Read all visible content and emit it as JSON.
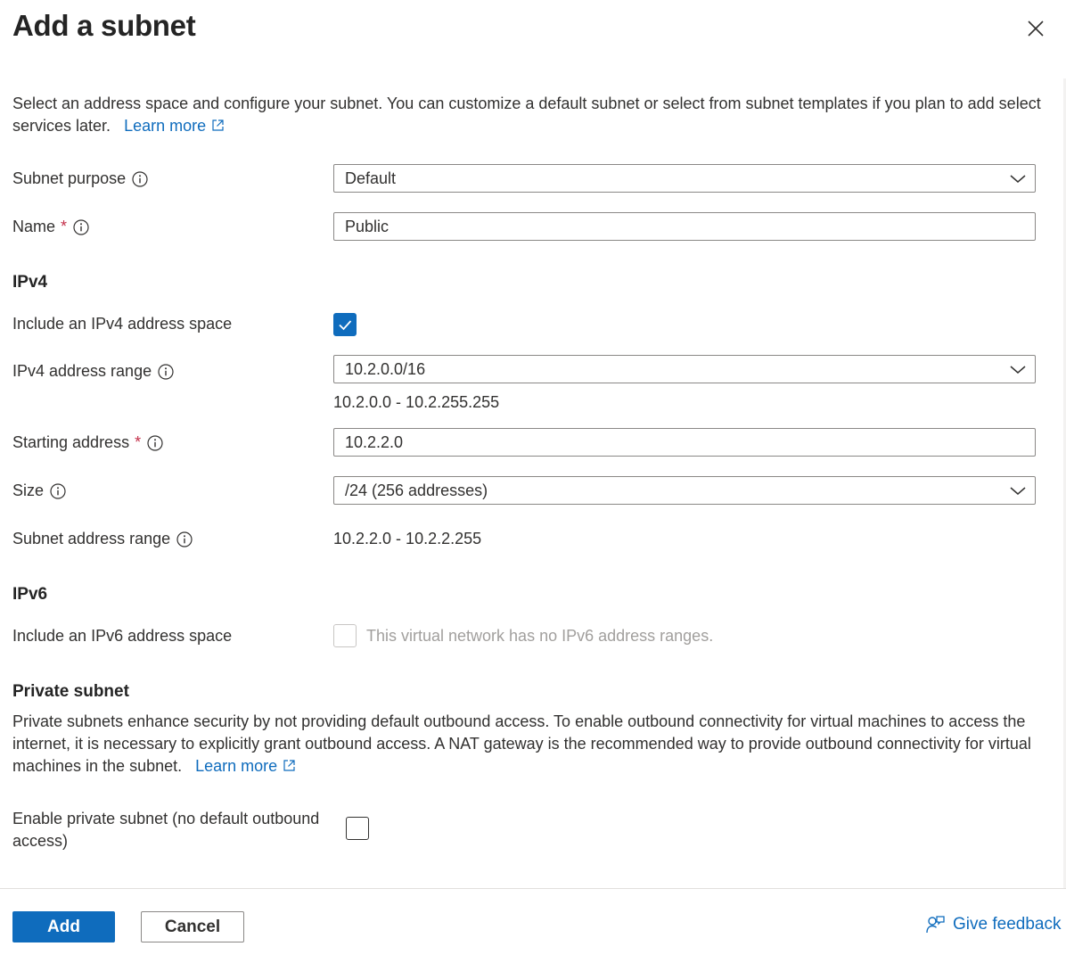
{
  "panel": {
    "title": "Add a subnet",
    "description": "Select an address space and configure your subnet. You can customize a default subnet or select from subnet templates if you plan to add select services later.",
    "learn_more": "Learn more"
  },
  "subnet_purpose": {
    "label": "Subnet purpose",
    "value": "Default"
  },
  "name": {
    "label": "Name",
    "required_mark": "*",
    "value": "Public"
  },
  "ipv4": {
    "heading": "IPv4",
    "include_label": "Include an IPv4 address space",
    "include_checked": true,
    "range_label": "IPv4 address range",
    "range_value": "10.2.0.0/16",
    "range_span": "10.2.0.0 - 10.2.255.255",
    "start_label": "Starting address",
    "start_required_mark": "*",
    "start_value": "10.2.2.0",
    "size_label": "Size",
    "size_value": "/24 (256 addresses)",
    "subnet_range_label": "Subnet address range",
    "subnet_range_value": "10.2.2.0 - 10.2.2.255"
  },
  "ipv6": {
    "heading": "IPv6",
    "include_label": "Include an IPv6 address space",
    "include_checked": false,
    "disabled_note": "This virtual network has no IPv6 address ranges."
  },
  "private_subnet": {
    "heading": "Private subnet",
    "description": "Private subnets enhance security by not providing default outbound access. To enable outbound connectivity for virtual machines to access the internet, it is necessary to explicitly grant outbound access. A NAT gateway is the recommended way to provide outbound connectivity for virtual machines in the subnet.",
    "learn_more": "Learn more",
    "enable_label": "Enable private subnet (no default outbound access)",
    "enable_checked": false
  },
  "footer": {
    "add_label": "Add",
    "cancel_label": "Cancel",
    "feedback_label": "Give feedback"
  },
  "icons": {
    "close": "close-icon",
    "info": "info-icon",
    "chevron": "chevron-down-icon",
    "external": "external-link-icon",
    "checkmark": "checkmark-icon",
    "feedback": "feedback-person-icon"
  },
  "colors": {
    "accent": "#0f6cbd",
    "required": "#c4314b",
    "text": "#323130",
    "disabled_text": "#a19f9d"
  }
}
